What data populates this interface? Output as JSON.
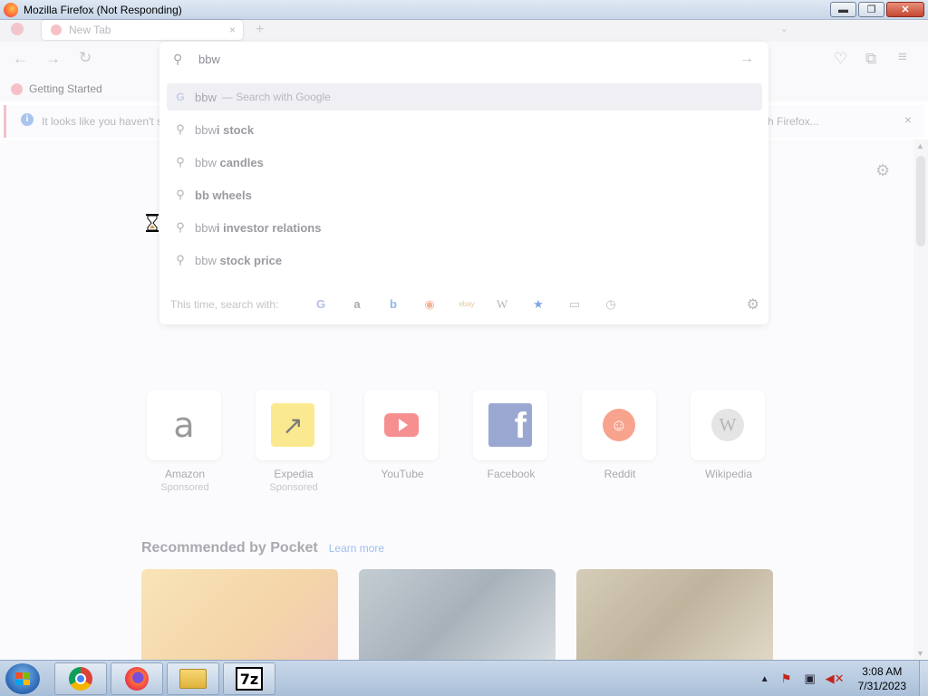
{
  "window": {
    "title": "Mozilla Firefox (Not Responding)",
    "buttons": {
      "minimize": "▬",
      "maximize": "❐",
      "close": "✕"
    }
  },
  "tab": {
    "title": "New Tab",
    "close": "×",
    "new_tab": "+",
    "list_all": "⌄"
  },
  "nav": {
    "back": "←",
    "forward": "→",
    "reload": "↻",
    "pocket": "♡",
    "extensions": "⧉",
    "menu": "≡"
  },
  "bookmarks": {
    "items": [
      {
        "label": "Getting Started"
      }
    ]
  },
  "notification": {
    "text_left": "It looks like you haven't s",
    "text_right": "h Firefox...",
    "close": "×"
  },
  "urlbar": {
    "value": "bbw",
    "suggestions": [
      {
        "typed": "bbw",
        "completion": "",
        "action": "— Search with Google",
        "icon": "google-icon"
      },
      {
        "typed": "bbw",
        "completion": "i stock",
        "icon": "search-icon"
      },
      {
        "typed": "bbw ",
        "completion": "candles",
        "icon": "search-icon"
      },
      {
        "typed": "",
        "completion": "bb wheels",
        "icon": "search-icon"
      },
      {
        "typed": "bbw",
        "completion": "i investor relations",
        "icon": "search-icon"
      },
      {
        "typed": "bbw ",
        "completion": "stock price",
        "icon": "search-icon"
      }
    ],
    "oneoff": {
      "label": "This time, search with:",
      "engines": [
        {
          "name": "google-icon",
          "glyph": "G"
        },
        {
          "name": "amazon-icon",
          "glyph": "a"
        },
        {
          "name": "bing-icon",
          "glyph": "b"
        },
        {
          "name": "duckduckgo-icon",
          "glyph": "◉"
        },
        {
          "name": "ebay-icon",
          "glyph": "ebay"
        },
        {
          "name": "wikipedia-icon",
          "glyph": "W"
        },
        {
          "name": "bookmarks-star-icon",
          "glyph": "★"
        },
        {
          "name": "tabs-icon",
          "glyph": "▭"
        },
        {
          "name": "history-icon",
          "glyph": "◷"
        }
      ]
    }
  },
  "top_sites": [
    {
      "name": "Amazon",
      "sub": "Sponsored"
    },
    {
      "name": "Expedia",
      "sub": "Sponsored"
    },
    {
      "name": "YouTube",
      "sub": ""
    },
    {
      "name": "Facebook",
      "sub": ""
    },
    {
      "name": "Reddit",
      "sub": ""
    },
    {
      "name": "Wikipedia",
      "sub": ""
    }
  ],
  "pocket": {
    "title": "Recommended by Pocket",
    "link": "Learn more"
  },
  "taskbar": {
    "clock_time": "3:08 AM",
    "clock_date": "7/31/2023",
    "sevenzip_label": "7z"
  }
}
